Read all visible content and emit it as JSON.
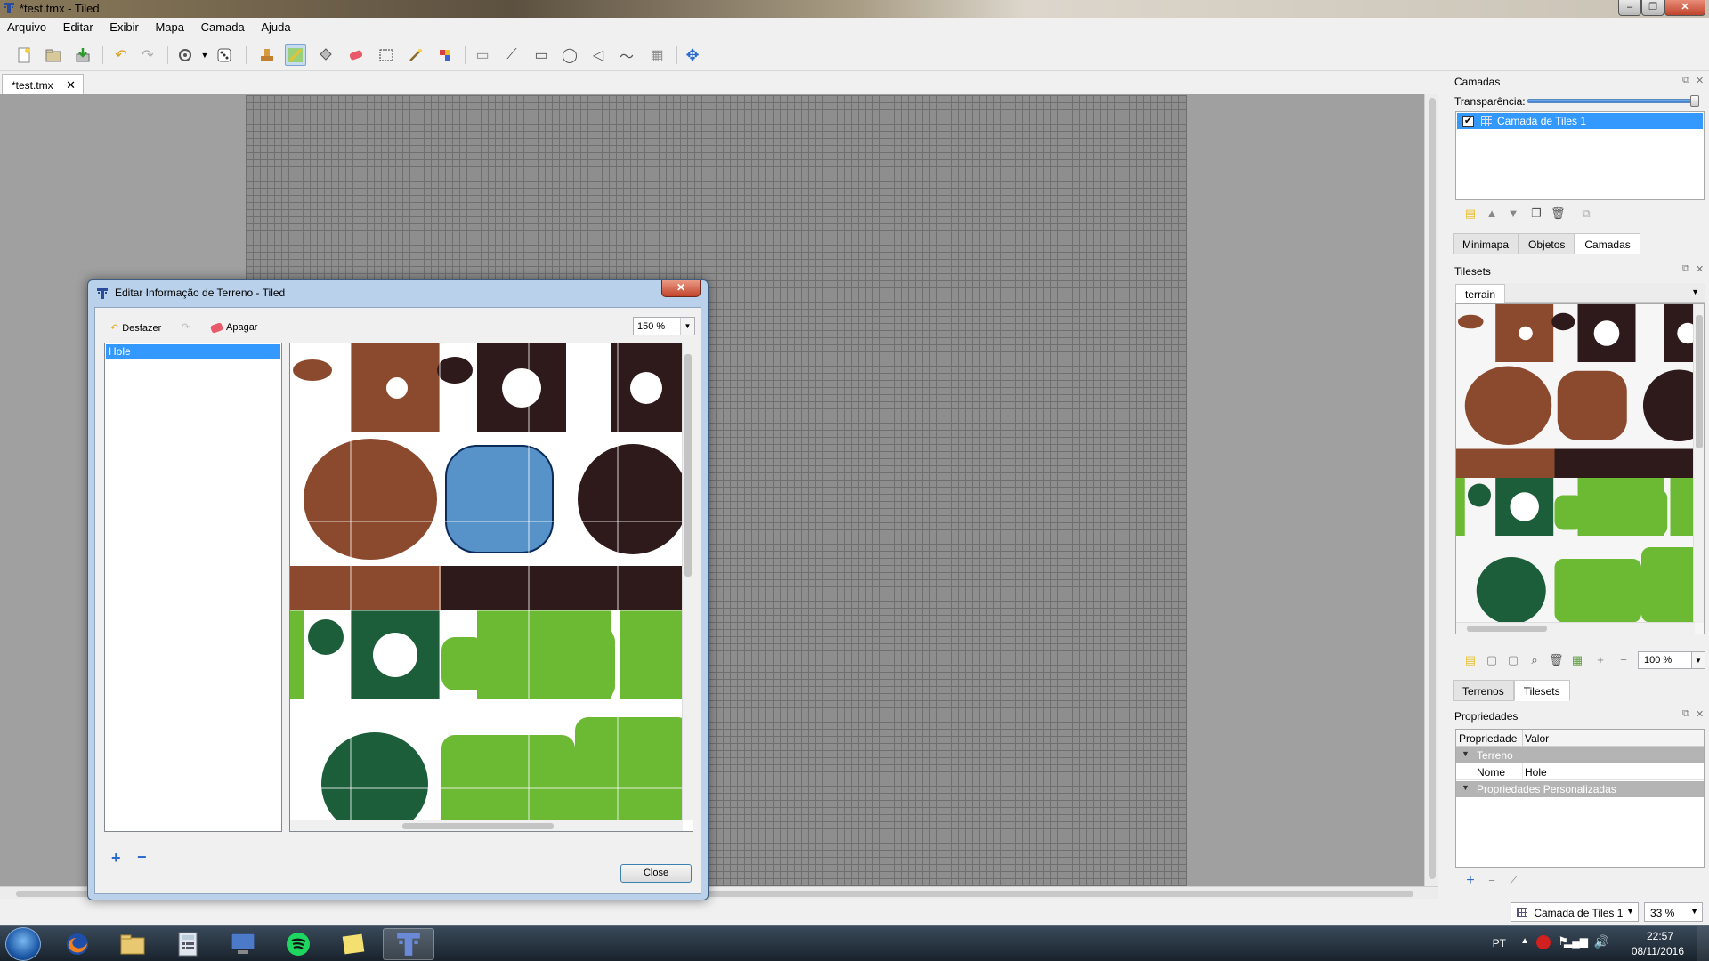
{
  "window": {
    "title": "*test.tmx - Tiled",
    "min": "‒",
    "max": "❐",
    "close": "✕"
  },
  "menu": [
    "Arquivo",
    "Editar",
    "Exibir",
    "Mapa",
    "Camada",
    "Ajuda"
  ],
  "document_tab": {
    "label": "*test.tmx",
    "close": "✕"
  },
  "layers_panel": {
    "title": "Camadas",
    "opacity_label": "Transparência:",
    "opacity": 1.0,
    "layers": [
      {
        "name": "Camada de Tiles 1",
        "visible": true
      }
    ],
    "tabs": [
      "Minimapa",
      "Objetos",
      "Camadas"
    ],
    "selected_tab": "Camadas"
  },
  "tilesets_panel": {
    "title": "Tilesets",
    "tab": "terrain",
    "zoom": "100 %",
    "tabs": [
      "Terrenos",
      "Tilesets"
    ],
    "selected_tab": "Tilesets"
  },
  "properties_panel": {
    "title": "Propriedades",
    "col_property": "Propriedade",
    "col_value": "Valor",
    "group_terrain": "Terreno",
    "row_name_label": "Nome",
    "row_name_value": "Hole",
    "group_custom": "Propriedades Personalizadas"
  },
  "statusbar": {
    "layer": "Camada de Tiles 1",
    "zoom": "33 %"
  },
  "dialog": {
    "title": "Editar Informação de Terreno - Tiled",
    "undo_label": "Desfazer",
    "erase_label": "Apagar",
    "zoom": "150 %",
    "terrains": [
      "Hole"
    ],
    "close_label": "Close",
    "add": "+",
    "remove": "−"
  },
  "taskbar": {
    "lang": "PT",
    "time": "22:57",
    "date": "08/11/2016"
  },
  "colors": {
    "selection": "#3399ff",
    "dirt": "#8b4a2e",
    "dark_hole": "#2e1a1a",
    "grass_light": "#6cba34",
    "grass_dark": "#1d5e3a"
  }
}
